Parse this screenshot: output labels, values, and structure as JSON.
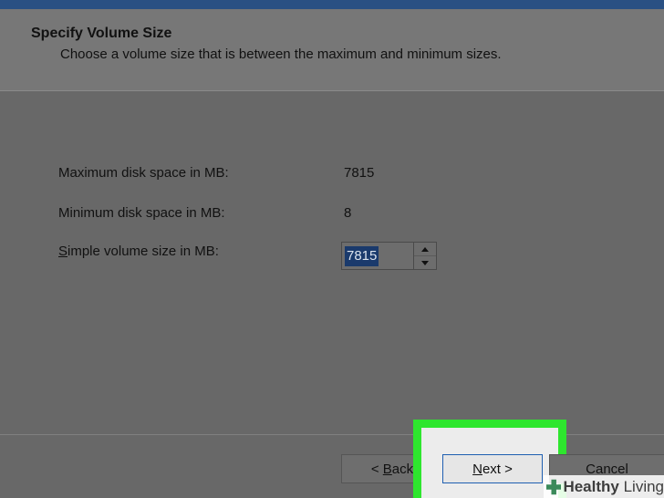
{
  "header": {
    "title": "Specify Volume Size",
    "subtitle": "Choose a volume size that is between the maximum and minimum sizes."
  },
  "fields": {
    "max_label": "Maximum disk space in MB:",
    "max_value": "7815",
    "min_label": "Minimum disk space in MB:",
    "min_value": "8",
    "size_label_first": "S",
    "size_label_rest": "imple volume size in MB:",
    "size_value": "7815"
  },
  "buttons": {
    "back_prefix": "< ",
    "back_accel": "B",
    "back_rest": "ack",
    "next_accel": "N",
    "next_rest": "ext >",
    "cancel": "Cancel"
  },
  "watermark": {
    "bold": "Healthy",
    "rest": " Living"
  },
  "colors": {
    "highlight": "#2ee62e",
    "selection": "#1a3a6c",
    "titlebar": "#2a5083"
  },
  "icons": [
    "chevron-up-icon",
    "chevron-down-icon",
    "plus-logo-icon"
  ]
}
